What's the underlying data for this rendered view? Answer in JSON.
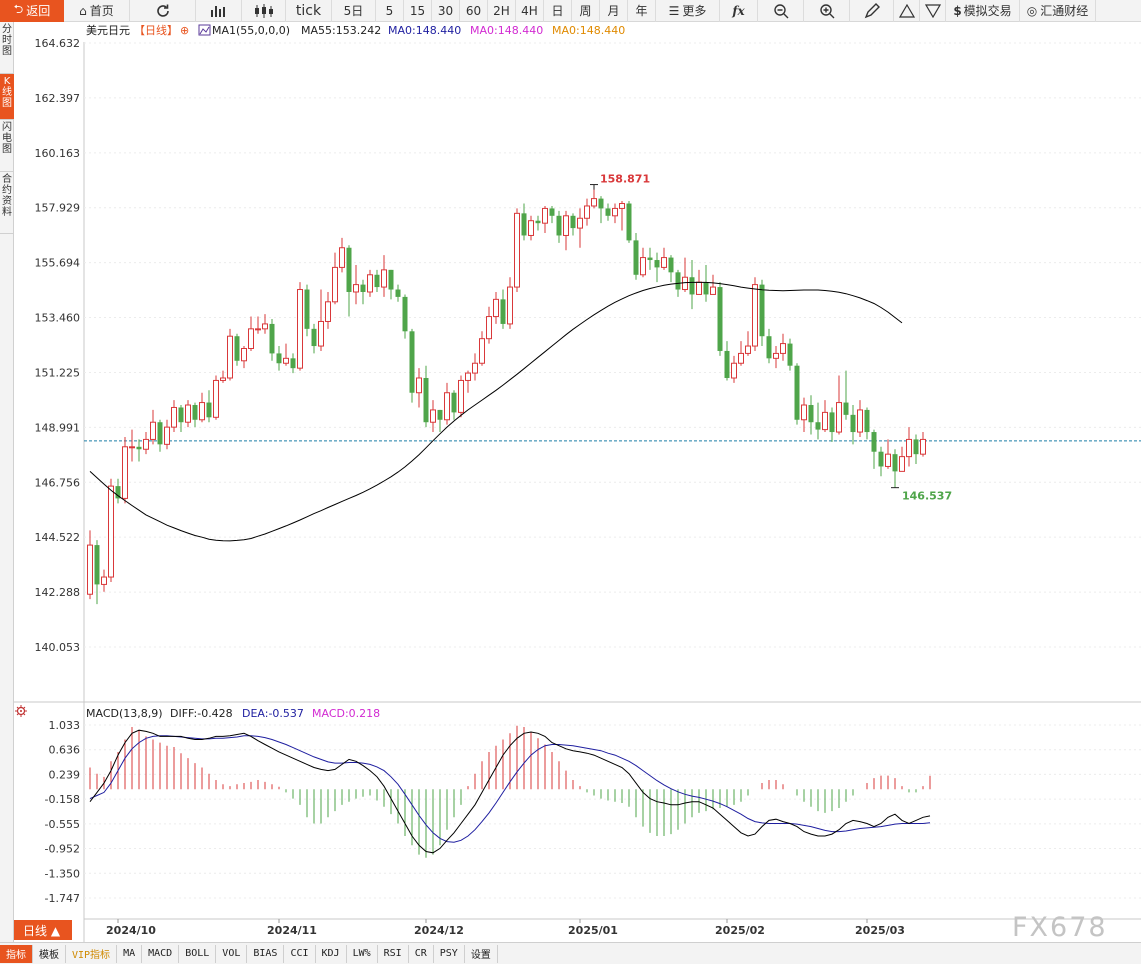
{
  "toolbar": {
    "back": "返回",
    "home": "首页",
    "tick": "tick",
    "days5": "5日",
    "m5": "5",
    "m15": "15",
    "m30": "30",
    "m60": "60",
    "h2": "2H",
    "h4": "4H",
    "day": "日",
    "week": "周",
    "month": "月",
    "year": "年",
    "more": "更多",
    "fx": "fx",
    "sim_trade": "模拟交易",
    "brand": "汇通财经"
  },
  "sidebar": [
    "分时图",
    "K线图",
    "闪电图",
    "合约资料"
  ],
  "legend": {
    "symbol": "美元日元",
    "period": "【日线】",
    "period_icon": "⊕",
    "ma1": "MA1(55,0,0,0)",
    "ma55": "MA55:153.242",
    "ma0_a": "MA0:148.440",
    "ma0_b": "MA0:148.440",
    "ma0_c": "MA0:148.440"
  },
  "macd_legend": {
    "title": "MACD(13,8,9)",
    "diff": "DIFF:-0.428",
    "dea": "DEA:-0.537",
    "macd": "MACD:0.218"
  },
  "period_button": "日线 ▲",
  "bottom_tabs": [
    "指标",
    "模板",
    "VIP指标",
    "MA",
    "MACD",
    "BOLL",
    "VOL",
    "BIAS",
    "CCI",
    "KDJ",
    "LW%",
    "RSI",
    "CR",
    "PSY",
    "设置"
  ],
  "watermark": "FX678",
  "colors": {
    "up": "#d9383a",
    "down": "#4fa54a",
    "ma": "#000000",
    "dea": "#1f1fa0",
    "ref_line": "#1f7fa8",
    "accent": "#e8541f"
  },
  "chart_data": {
    "type": "candlestick",
    "title": "美元日元 日线",
    "price_axis": {
      "min": 140.053,
      "max": 164.632,
      "ticks": [
        164.632,
        162.397,
        160.163,
        157.929,
        155.694,
        153.46,
        151.225,
        148.991,
        146.756,
        144.522,
        142.288,
        140.053
      ]
    },
    "macd_axis": {
      "ticks": [
        1.033,
        0.636,
        0.239,
        -0.158,
        -0.555,
        -0.952,
        -1.35,
        -1.747
      ]
    },
    "x_labels": [
      {
        "i": 4,
        "label": "2024/10"
      },
      {
        "i": 27,
        "label": "2024/11"
      },
      {
        "i": 48,
        "label": "2024/12"
      },
      {
        "i": 70,
        "label": "2025/01"
      },
      {
        "i": 91,
        "label": "2025/02"
      },
      {
        "i": 111,
        "label": "2025/03"
      }
    ],
    "ref_price": 148.44,
    "high_mark": {
      "i": 72,
      "price": 158.871,
      "label": "158.871"
    },
    "low_mark": {
      "i": 115,
      "price": 146.537,
      "label": "146.537"
    },
    "candles": [
      [
        142.2,
        144.2,
        144.8,
        142.0
      ],
      [
        144.2,
        142.6,
        144.4,
        141.8
      ],
      [
        142.6,
        142.9,
        143.2,
        142.3
      ],
      [
        142.9,
        146.6,
        146.9,
        142.7
      ],
      [
        146.6,
        146.1,
        146.9,
        145.9
      ],
      [
        146.1,
        148.2,
        148.6,
        145.9
      ],
      [
        148.2,
        148.2,
        148.9,
        147.6
      ],
      [
        148.2,
        148.1,
        148.5,
        147.6
      ],
      [
        148.1,
        148.5,
        148.8,
        147.9
      ],
      [
        148.5,
        149.2,
        149.7,
        148.3
      ],
      [
        149.2,
        148.3,
        149.3,
        148.0
      ],
      [
        148.3,
        149.0,
        149.3,
        148.1
      ],
      [
        149.0,
        149.8,
        150.1,
        148.8
      ],
      [
        149.8,
        149.2,
        149.9,
        148.8
      ],
      [
        149.2,
        149.9,
        150.1,
        149.0
      ],
      [
        149.9,
        149.3,
        150.0,
        149.0
      ],
      [
        149.3,
        150.0,
        150.4,
        149.2
      ],
      [
        150.0,
        149.4,
        150.5,
        149.2
      ],
      [
        149.4,
        150.9,
        151.1,
        149.3
      ],
      [
        150.9,
        151.0,
        151.3,
        150.8
      ],
      [
        151.0,
        152.7,
        153.0,
        150.9
      ],
      [
        152.7,
        151.7,
        152.8,
        151.5
      ],
      [
        151.7,
        152.2,
        152.3,
        151.4
      ],
      [
        152.2,
        153.0,
        153.5,
        152.1
      ],
      [
        153.0,
        153.0,
        153.5,
        152.8
      ],
      [
        153.0,
        153.2,
        153.6,
        152.8
      ],
      [
        153.2,
        152.0,
        153.4,
        151.7
      ],
      [
        152.0,
        151.6,
        152.3,
        151.3
      ],
      [
        151.6,
        151.8,
        152.4,
        151.5
      ],
      [
        151.8,
        151.4,
        152.0,
        151.2
      ],
      [
        151.4,
        154.6,
        154.9,
        151.3
      ],
      [
        154.6,
        153.0,
        154.8,
        152.7
      ],
      [
        153.0,
        152.3,
        153.2,
        152.0
      ],
      [
        152.3,
        153.3,
        154.6,
        152.1
      ],
      [
        153.3,
        154.1,
        154.5,
        153.0
      ],
      [
        154.1,
        155.5,
        156.1,
        154.0
      ],
      [
        155.5,
        156.3,
        156.7,
        155.3
      ],
      [
        156.3,
        154.5,
        156.4,
        153.5
      ],
      [
        154.5,
        154.8,
        155.6,
        154.0
      ],
      [
        154.8,
        154.5,
        155.0,
        154.0
      ],
      [
        154.5,
        155.2,
        155.4,
        154.3
      ],
      [
        155.2,
        154.7,
        155.4,
        154.5
      ],
      [
        154.7,
        155.4,
        156.0,
        154.3
      ],
      [
        155.4,
        154.6,
        155.4,
        154.2
      ],
      [
        154.6,
        154.3,
        154.8,
        154.1
      ],
      [
        154.3,
        152.9,
        154.4,
        152.6
      ],
      [
        152.9,
        150.4,
        153.0,
        150.0
      ],
      [
        150.4,
        151.0,
        151.4,
        149.8
      ],
      [
        151.0,
        149.2,
        151.5,
        149.0
      ],
      [
        149.2,
        149.7,
        150.1,
        148.8
      ],
      [
        149.7,
        149.3,
        149.7,
        148.8
      ],
      [
        149.3,
        150.4,
        150.8,
        149.1
      ],
      [
        150.4,
        149.6,
        150.5,
        149.3
      ],
      [
        149.6,
        150.9,
        151.1,
        149.4
      ],
      [
        150.9,
        151.2,
        151.3,
        150.4
      ],
      [
        151.2,
        151.6,
        152.0,
        150.9
      ],
      [
        151.6,
        152.6,
        152.9,
        151.5
      ],
      [
        152.6,
        153.5,
        153.9,
        152.4
      ],
      [
        153.5,
        154.2,
        154.5,
        153.2
      ],
      [
        154.2,
        153.2,
        154.6,
        153.0
      ],
      [
        153.2,
        154.7,
        155.1,
        153.0
      ],
      [
        154.7,
        157.7,
        157.9,
        154.5
      ],
      [
        157.7,
        156.8,
        158.1,
        156.6
      ],
      [
        156.8,
        157.4,
        157.6,
        156.6
      ],
      [
        157.4,
        157.3,
        157.6,
        157.0
      ],
      [
        157.3,
        157.9,
        158.0,
        156.9
      ],
      [
        157.9,
        157.6,
        158.0,
        157.3
      ],
      [
        157.6,
        156.8,
        157.8,
        156.5
      ],
      [
        156.8,
        157.6,
        157.8,
        156.2
      ],
      [
        157.6,
        157.1,
        157.7,
        156.8
      ],
      [
        157.1,
        157.5,
        157.9,
        156.3
      ],
      [
        157.5,
        158.0,
        158.3,
        157.2
      ],
      [
        158.0,
        158.3,
        158.87,
        157.9
      ],
      [
        158.3,
        157.9,
        158.4,
        157.3
      ],
      [
        157.9,
        157.6,
        158.1,
        157.4
      ],
      [
        157.6,
        157.9,
        158.1,
        157.3
      ],
      [
        157.9,
        158.1,
        158.2,
        157.0
      ],
      [
        158.1,
        156.6,
        158.2,
        156.5
      ],
      [
        156.6,
        155.2,
        156.9,
        155.0
      ],
      [
        155.2,
        155.9,
        156.3,
        155.1
      ],
      [
        155.9,
        155.8,
        156.3,
        155.4
      ],
      [
        155.8,
        155.5,
        156.1,
        154.9
      ],
      [
        155.5,
        155.9,
        156.3,
        155.4
      ],
      [
        155.9,
        155.3,
        156.0,
        154.9
      ],
      [
        155.3,
        154.6,
        155.4,
        154.3
      ],
      [
        154.6,
        155.1,
        155.9,
        154.5
      ],
      [
        155.1,
        154.4,
        155.8,
        153.8
      ],
      [
        154.4,
        154.9,
        155.4,
        154.5
      ],
      [
        154.9,
        154.4,
        155.6,
        154.1
      ],
      [
        154.4,
        154.7,
        155.2,
        154.4
      ],
      [
        154.7,
        152.1,
        154.9,
        151.9
      ],
      [
        152.1,
        151.0,
        152.5,
        150.9
      ],
      [
        151.0,
        151.6,
        151.9,
        150.8
      ],
      [
        151.6,
        152.0,
        152.5,
        151.5
      ],
      [
        152.0,
        152.3,
        152.9,
        151.9
      ],
      [
        152.3,
        154.8,
        155.1,
        152.1
      ],
      [
        154.8,
        152.7,
        155.0,
        152.3
      ],
      [
        152.7,
        151.8,
        153.0,
        151.6
      ],
      [
        151.8,
        152.0,
        152.3,
        151.4
      ],
      [
        152.0,
        152.4,
        152.8,
        151.7
      ],
      [
        152.4,
        151.5,
        152.6,
        151.3
      ],
      [
        151.5,
        149.3,
        151.6,
        149.1
      ],
      [
        149.3,
        149.9,
        150.2,
        148.8
      ],
      [
        149.9,
        149.2,
        150.3,
        148.7
      ],
      [
        149.2,
        148.9,
        150.0,
        148.5
      ],
      [
        148.9,
        149.6,
        150.1,
        148.8
      ],
      [
        149.6,
        148.8,
        149.8,
        148.4
      ],
      [
        148.8,
        150.0,
        151.1,
        148.7
      ],
      [
        150.0,
        149.5,
        151.3,
        149.3
      ],
      [
        149.5,
        148.8,
        149.9,
        148.3
      ],
      [
        148.8,
        149.7,
        150.1,
        148.6
      ],
      [
        149.7,
        148.8,
        149.8,
        148.5
      ],
      [
        148.8,
        148.0,
        148.9,
        147.3
      ],
      [
        148.0,
        147.4,
        148.2,
        147.0
      ],
      [
        147.4,
        147.9,
        148.5,
        147.3
      ],
      [
        147.9,
        147.2,
        148.1,
        146.537
      ],
      [
        147.2,
        147.8,
        148.2,
        147.3
      ],
      [
        147.8,
        148.5,
        149.0,
        147.4
      ],
      [
        148.5,
        147.9,
        148.7,
        147.5
      ],
      [
        147.9,
        148.5,
        148.8,
        147.8
      ]
    ],
    "ma55": [
      147.2,
      146.94,
      146.68,
      146.43,
      146.21,
      146.01,
      145.81,
      145.62,
      145.43,
      145.29,
      145.15,
      145.01,
      144.9,
      144.79,
      144.69,
      144.59,
      144.52,
      144.44,
      144.4,
      144.38,
      144.37,
      144.39,
      144.42,
      144.47,
      144.56,
      144.65,
      144.76,
      144.87,
      144.98,
      145.1,
      145.22,
      145.35,
      145.48,
      145.6,
      145.73,
      145.85,
      145.98,
      146.1,
      146.22,
      146.35,
      146.49,
      146.64,
      146.81,
      146.98,
      147.17,
      147.38,
      147.62,
      147.88,
      148.16,
      148.45,
      148.73,
      149.0,
      149.25,
      149.48,
      149.7,
      149.9,
      150.1,
      150.3,
      150.5,
      150.71,
      150.93,
      151.15,
      151.38,
      151.61,
      151.84,
      152.07,
      152.3,
      152.53,
      152.76,
      152.98,
      153.18,
      153.38,
      153.57,
      153.75,
      153.92,
      154.08,
      154.22,
      154.35,
      154.46,
      154.56,
      154.64,
      154.71,
      154.77,
      154.82,
      154.85,
      154.88,
      154.89,
      154.89,
      154.89,
      154.87,
      154.84,
      154.8,
      154.75,
      154.7,
      154.66,
      154.62,
      154.59,
      154.57,
      154.56,
      154.55,
      154.56,
      154.57,
      154.58,
      154.58,
      154.58,
      154.56,
      154.53,
      154.49,
      154.43,
      154.35,
      154.26,
      154.15,
      154.03,
      153.87,
      153.68,
      153.46,
      153.242
    ],
    "macd_hist": [
      0.35,
      0.25,
      0.2,
      0.45,
      0.6,
      0.8,
      1.0,
      0.95,
      0.85,
      0.8,
      0.75,
      0.7,
      0.68,
      0.58,
      0.5,
      0.42,
      0.35,
      0.25,
      0.15,
      0.08,
      0.05,
      0.08,
      0.1,
      0.12,
      0.15,
      0.12,
      0.08,
      0.04,
      -0.05,
      -0.15,
      -0.25,
      -0.45,
      -0.55,
      -0.55,
      -0.45,
      -0.35,
      -0.25,
      -0.2,
      -0.15,
      -0.12,
      -0.1,
      -0.18,
      -0.28,
      -0.4,
      -0.55,
      -0.75,
      -0.9,
      -1.05,
      -1.1,
      -1.05,
      -0.9,
      -0.65,
      -0.45,
      -0.25,
      0.05,
      0.25,
      0.45,
      0.6,
      0.7,
      0.8,
      0.9,
      1.02,
      1.0,
      0.92,
      0.82,
      0.72,
      0.6,
      0.45,
      0.3,
      0.15,
      0.05,
      -0.05,
      -0.1,
      -0.15,
      -0.18,
      -0.2,
      -0.22,
      -0.28,
      -0.45,
      -0.6,
      -0.7,
      -0.75,
      -0.75,
      -0.72,
      -0.65,
      -0.55,
      -0.45,
      -0.38,
      -0.35,
      -0.32,
      -0.3,
      -0.28,
      -0.25,
      -0.2,
      -0.1,
      0.0,
      0.1,
      0.15,
      0.15,
      0.08,
      0.0,
      -0.1,
      -0.2,
      -0.28,
      -0.35,
      -0.38,
      -0.35,
      -0.3,
      -0.2,
      -0.1,
      0.0,
      0.1,
      0.18,
      0.22,
      0.22,
      0.18,
      0.05,
      -0.05,
      -0.05,
      0.05,
      0.218
    ],
    "macd_diff": [
      -0.2,
      -0.05,
      0.1,
      0.3,
      0.55,
      0.75,
      0.9,
      0.95,
      0.93,
      0.9,
      0.85,
      0.85,
      0.85,
      0.85,
      0.82,
      0.8,
      0.8,
      0.82,
      0.85,
      0.85,
      0.86,
      0.88,
      0.9,
      0.85,
      0.78,
      0.72,
      0.66,
      0.6,
      0.55,
      0.5,
      0.45,
      0.4,
      0.35,
      0.32,
      0.3,
      0.32,
      0.4,
      0.48,
      0.45,
      0.38,
      0.3,
      0.2,
      0.05,
      -0.15,
      -0.35,
      -0.55,
      -0.75,
      -0.9,
      -1.0,
      -1.02,
      -0.95,
      -0.82,
      -0.7,
      -0.55,
      -0.4,
      -0.25,
      -0.05,
      0.15,
      0.35,
      0.55,
      0.7,
      0.82,
      0.9,
      0.92,
      0.9,
      0.85,
      0.75,
      0.7,
      0.65,
      0.62,
      0.6,
      0.58,
      0.55,
      0.5,
      0.45,
      0.4,
      0.35,
      0.25,
      0.1,
      -0.05,
      -0.15,
      -0.2,
      -0.22,
      -0.25,
      -0.25,
      -0.22,
      -0.2,
      -0.2,
      -0.25,
      -0.3,
      -0.4,
      -0.5,
      -0.6,
      -0.7,
      -0.75,
      -0.72,
      -0.6,
      -0.5,
      -0.48,
      -0.52,
      -0.55,
      -0.6,
      -0.68,
      -0.72,
      -0.75,
      -0.75,
      -0.72,
      -0.65,
      -0.55,
      -0.5,
      -0.52,
      -0.55,
      -0.6,
      -0.55,
      -0.45,
      -0.4,
      -0.5,
      -0.55,
      -0.5,
      -0.45,
      -0.428
    ],
    "macd_dea": [
      -0.15,
      -0.1,
      -0.05,
      0.1,
      0.3,
      0.5,
      0.65,
      0.75,
      0.82,
      0.85,
      0.86,
      0.86,
      0.85,
      0.84,
      0.83,
      0.82,
      0.81,
      0.81,
      0.82,
      0.82,
      0.83,
      0.84,
      0.86,
      0.86,
      0.85,
      0.83,
      0.8,
      0.76,
      0.72,
      0.67,
      0.62,
      0.57,
      0.52,
      0.48,
      0.44,
      0.42,
      0.42,
      0.43,
      0.43,
      0.42,
      0.4,
      0.36,
      0.3,
      0.2,
      0.08,
      -0.08,
      -0.25,
      -0.42,
      -0.57,
      -0.7,
      -0.79,
      -0.84,
      -0.85,
      -0.82,
      -0.75,
      -0.65,
      -0.52,
      -0.38,
      -0.22,
      -0.05,
      0.12,
      0.28,
      0.42,
      0.55,
      0.64,
      0.7,
      0.72,
      0.72,
      0.71,
      0.7,
      0.68,
      0.66,
      0.64,
      0.62,
      0.58,
      0.55,
      0.5,
      0.45,
      0.38,
      0.3,
      0.22,
      0.14,
      0.07,
      0.01,
      -0.04,
      -0.08,
      -0.11,
      -0.13,
      -0.16,
      -0.19,
      -0.23,
      -0.28,
      -0.34,
      -0.4,
      -0.47,
      -0.52,
      -0.54,
      -0.55,
      -0.55,
      -0.55,
      -0.55,
      -0.56,
      -0.58,
      -0.6,
      -0.63,
      -0.66,
      -0.68,
      -0.68,
      -0.67,
      -0.65,
      -0.63,
      -0.62,
      -0.61,
      -0.6,
      -0.58,
      -0.56,
      -0.55,
      -0.55,
      -0.55,
      -0.55,
      -0.537
    ]
  }
}
